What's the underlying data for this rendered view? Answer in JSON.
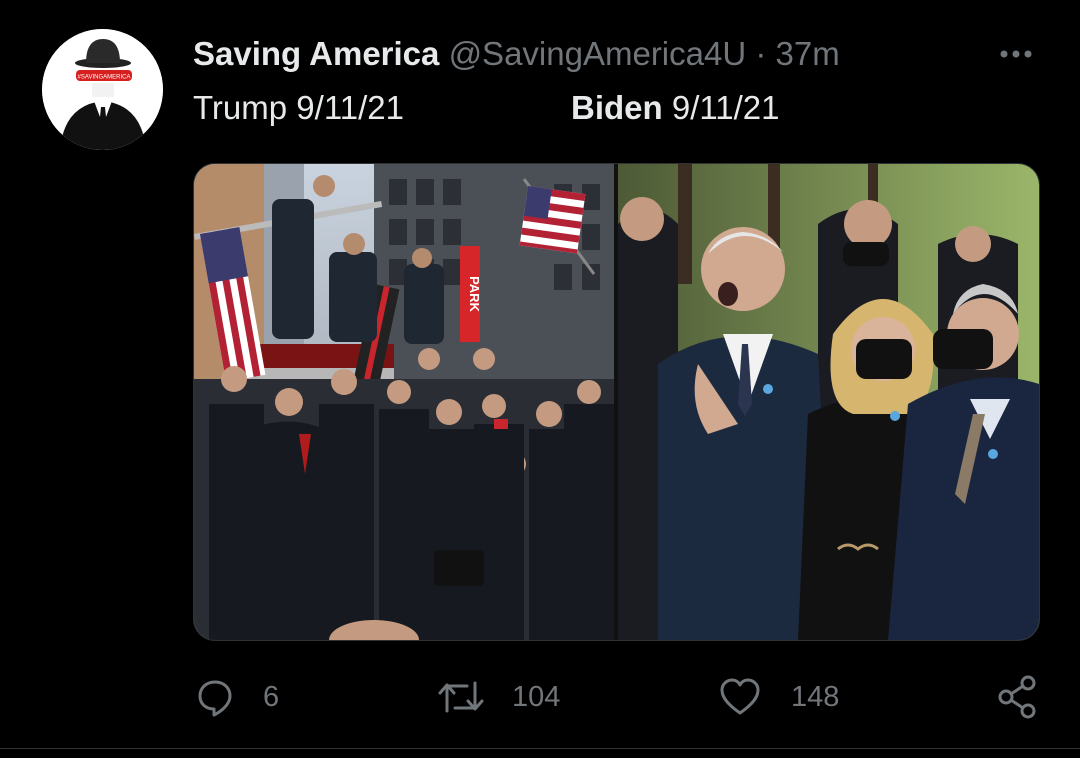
{
  "tweet": {
    "display_name": "Saving America",
    "handle": "@SavingAmerica4U",
    "separator": "·",
    "time": "37m",
    "avatar": {
      "icon": "bowler-hat-suit-avatar-icon",
      "label": "#SAVINGAMERICA"
    },
    "caption": {
      "left": {
        "name": "Trump",
        "date": "9/11/21"
      },
      "right": {
        "name": "Biden",
        "date": "9/11/21"
      }
    },
    "media": {
      "left": {
        "description": "trump-with-firefighters-photo",
        "sign_text": "PARK"
      },
      "right": {
        "description": "biden-at-memorial-photo"
      }
    },
    "actions": {
      "reply": {
        "icon": "reply-icon",
        "count": "6"
      },
      "retweet": {
        "icon": "retweet-icon",
        "count": "104"
      },
      "like": {
        "icon": "heart-icon",
        "count": "148"
      },
      "share": {
        "icon": "share-icon"
      }
    },
    "colors": {
      "background": "#000000",
      "text": "#e7e9ea",
      "secondary": "#71767b"
    }
  }
}
